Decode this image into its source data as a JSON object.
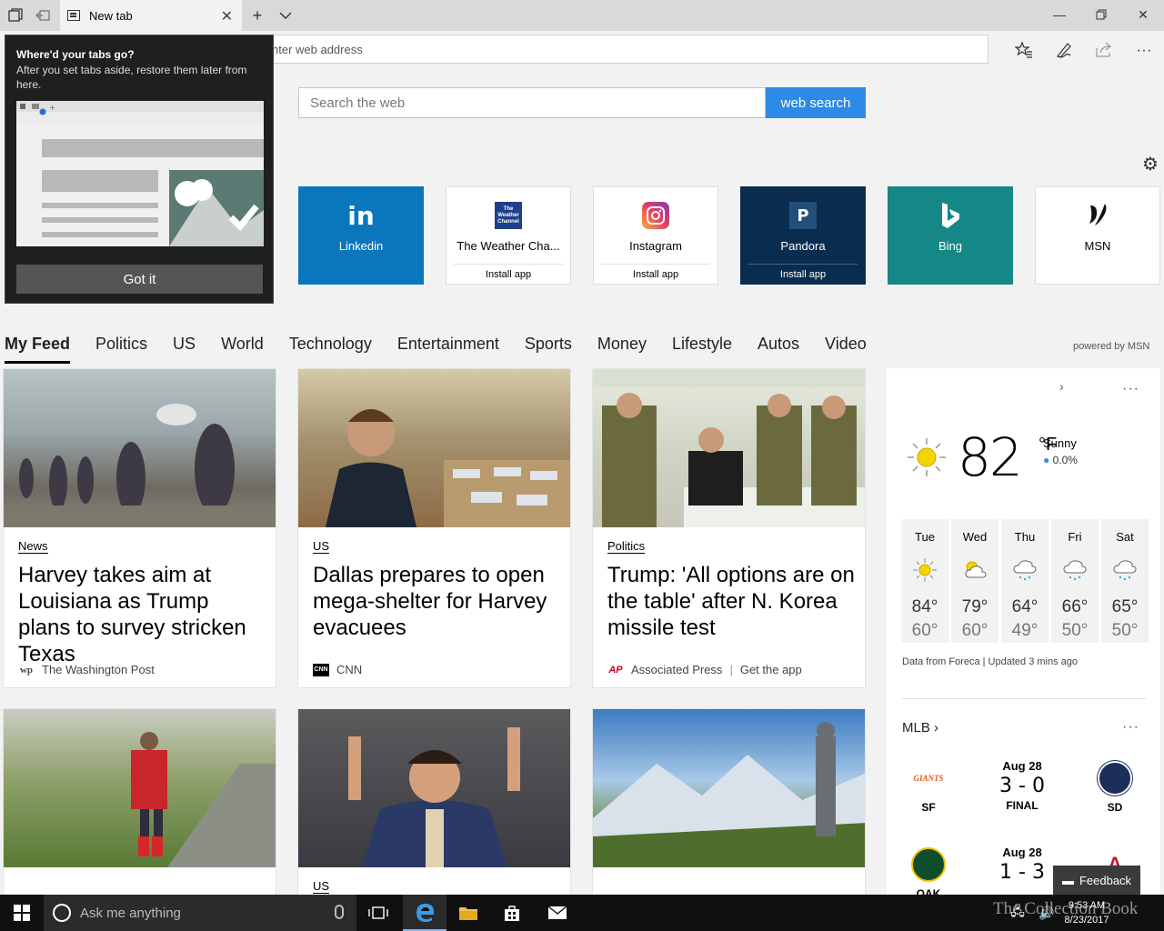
{
  "browser": {
    "tab_title": "New tab",
    "address_placeholder": "nter web address"
  },
  "search": {
    "placeholder": "Search the web",
    "button_label": "web search"
  },
  "tiles": [
    {
      "name": "Linkedin",
      "icon": "linkedin-icon",
      "icon_glyph": "in",
      "bg": "#0a77bd",
      "fg": "#ffffff",
      "install": ""
    },
    {
      "name": "The Weather Cha...",
      "icon": "weather-channel-icon",
      "icon_glyph": "The Weather Channel",
      "bg": "#ffffff",
      "fg": "#000000",
      "install": "Install app"
    },
    {
      "name": "Instagram",
      "icon": "instagram-icon",
      "icon_glyph": "",
      "bg": "#ffffff",
      "fg": "#000000",
      "install": "Install app"
    },
    {
      "name": "Pandora",
      "icon": "pandora-icon",
      "icon_glyph": "P",
      "bg": "#0a2d4f",
      "fg": "#ffffff",
      "install": "Install app"
    },
    {
      "name": "Bing",
      "icon": "bing-icon",
      "icon_glyph": "b",
      "bg": "#168787",
      "fg": "#ffffff",
      "install": ""
    },
    {
      "name": "MSN",
      "icon": "msn-icon",
      "icon_glyph": "",
      "bg": "#ffffff",
      "fg": "#000000",
      "install": ""
    }
  ],
  "feed_nav": [
    "My Feed",
    "Politics",
    "US",
    "World",
    "Technology",
    "Entertainment",
    "Sports",
    "Money",
    "Lifestyle",
    "Autos",
    "Video"
  ],
  "powered_by": "powered by MSN",
  "cards": [
    {
      "category": "News",
      "headline": "Harvey takes aim at Louisiana as Trump plans to survey stricken Texas",
      "source": "The Washington Post",
      "source_logo": "wp",
      "image": "flood-evacuees-photo"
    },
    {
      "category": "US",
      "headline": "Dallas prepares to open mega-shelter for Harvey evacuees",
      "source": "CNN",
      "source_logo": "CNN",
      "image": "police-officer-shelter-photo"
    },
    {
      "category": "Politics",
      "headline": "Trump: 'All options are on the table' after N. Korea missile test",
      "source": "Associated Press",
      "source_extra": "Get the app",
      "source_logo": "AP",
      "image": "north-korea-officials-photo"
    },
    {
      "category": "",
      "headline": "",
      "source": "",
      "image": "red-cross-worker-photo"
    },
    {
      "category": "US",
      "headline": "",
      "source": "",
      "image": "preacher-photo"
    },
    {
      "category": "",
      "headline": "",
      "source": "",
      "image": "fantasy-landscape-photo"
    }
  ],
  "weather": {
    "temp": "82",
    "unit": "°F",
    "condition": "Sunny",
    "precip": "0.0%",
    "forecast": [
      {
        "day": "Tue",
        "icon": "sun-icon",
        "hi": "84°",
        "lo": "60°"
      },
      {
        "day": "Wed",
        "icon": "partly-cloudy-icon",
        "hi": "79°",
        "lo": "60°"
      },
      {
        "day": "Thu",
        "icon": "rain-icon",
        "hi": "64°",
        "lo": "49°"
      },
      {
        "day": "Fri",
        "icon": "rain-icon",
        "hi": "66°",
        "lo": "50°"
      },
      {
        "day": "Sat",
        "icon": "rain-icon",
        "hi": "65°",
        "lo": "50°"
      }
    ],
    "credit": "Data from Foreca | Updated 3 mins ago"
  },
  "mlb": {
    "title": "MLB",
    "games": [
      {
        "date": "Aug 28",
        "score": "3 - 0",
        "status": "FINAL",
        "away": "SF",
        "away_logo": "GIANTS",
        "home": "SD"
      },
      {
        "date": "Aug 28",
        "score": "1 - 3",
        "status": "",
        "away": "OAK",
        "home": ""
      }
    ]
  },
  "feedback_label": "Feedback",
  "popup": {
    "title": "Where'd your tabs go?",
    "body": "After you set tabs aside, restore them later from here.",
    "button": "Got it"
  },
  "taskbar": {
    "search_placeholder": "Ask me anything",
    "time": "9:53 AM",
    "date": "8/23/2017",
    "watermark": "The Collection Book"
  }
}
